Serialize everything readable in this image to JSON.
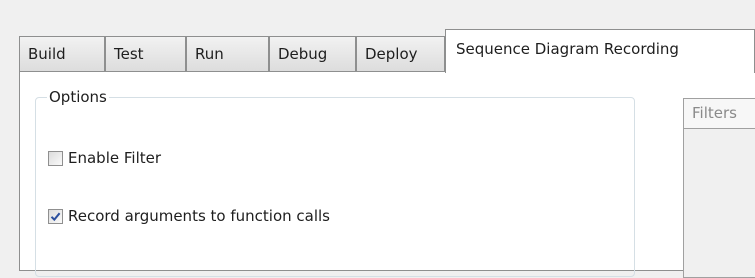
{
  "tabs": [
    {
      "label": "Build",
      "active": false
    },
    {
      "label": "Test",
      "active": false
    },
    {
      "label": "Run",
      "active": false
    },
    {
      "label": "Debug",
      "active": false
    },
    {
      "label": "Deploy",
      "active": false
    },
    {
      "label": "Sequence Diagram Recording",
      "active": true
    }
  ],
  "options": {
    "group_label": "Options",
    "enable_filter": {
      "label": "Enable Filter",
      "checked": false
    },
    "record_arguments": {
      "label": "Record arguments to function calls",
      "checked": true
    }
  },
  "filters": {
    "header_label": "Filters"
  },
  "colors": {
    "check_mark": "#2b4f9e",
    "tab_border": "#8e8f8f",
    "group_border": "#d5dfe5"
  }
}
